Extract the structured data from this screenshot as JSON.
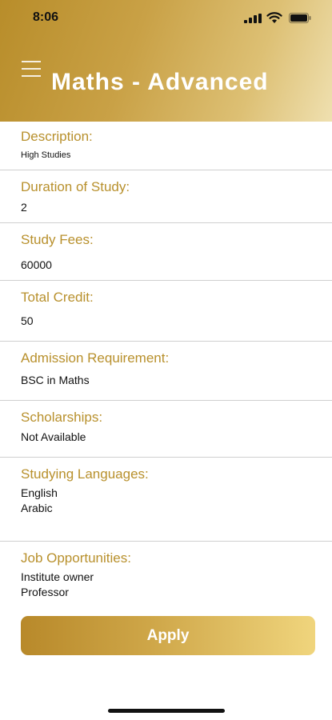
{
  "status": {
    "time": "8:06"
  },
  "header": {
    "title": "Maths - Advanced"
  },
  "details": [
    {
      "label": "Description:",
      "lines": [
        "High Studies"
      ]
    },
    {
      "label": "Duration of Study:",
      "lines": [
        "2"
      ]
    },
    {
      "label": "Study Fees:",
      "lines": [
        "60000"
      ]
    },
    {
      "label": "Total Credit:",
      "lines": [
        "50"
      ]
    },
    {
      "label": "Admission Requirement:",
      "lines": [
        "BSC in Maths"
      ]
    },
    {
      "label": "Scholarships:",
      "lines": [
        "Not Available"
      ]
    },
    {
      "label": "Studying Languages:",
      "lines": [
        "English",
        "Arabic"
      ]
    },
    {
      "label": "Job Opportunities:",
      "lines": [
        "Institute owner",
        "Professor"
      ]
    }
  ],
  "apply": {
    "label": "Apply"
  },
  "colors": {
    "accent": "#b8902c",
    "header_start": "#b88d2a",
    "header_end": "#efe0b0"
  },
  "icons": [
    "signal-icon",
    "wifi-icon",
    "battery-icon",
    "menu-icon"
  ]
}
